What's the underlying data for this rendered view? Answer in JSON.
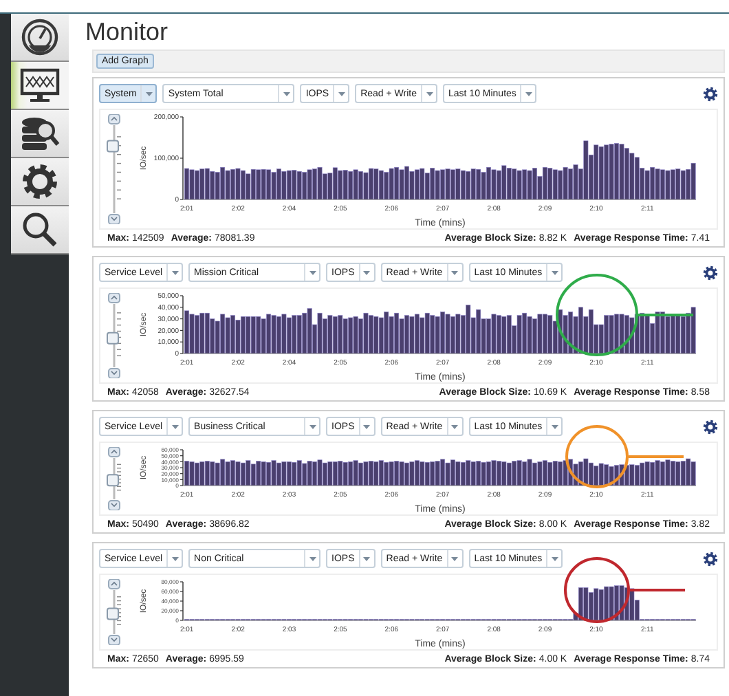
{
  "sidebar": {
    "items": [
      {
        "kind": "dashboard",
        "selected": false
      },
      {
        "kind": "monitor",
        "selected": true
      },
      {
        "kind": "storage",
        "selected": false
      },
      {
        "kind": "settings",
        "selected": false
      },
      {
        "kind": "search",
        "selected": false
      }
    ]
  },
  "page": {
    "title": "Monitor"
  },
  "toolbar": {
    "buttons": [
      "Add Graph"
    ]
  },
  "graphs": [
    {
      "controls": [
        {
          "value": "System",
          "focused": true
        },
        {
          "value": "System Total",
          "focused": false
        },
        {
          "value": "IOPS",
          "focused": false
        },
        {
          "value": "Read + Write",
          "focused": false
        },
        {
          "value": "Last 10 Minutes",
          "focused": false
        }
      ],
      "chart_data": {
        "type": "bar",
        "xlabel": "Time (mins)",
        "ylabel": "IO/sec",
        "ylim": [
          0,
          200000
        ],
        "yticks": [
          {
            "value": 0,
            "label": "0"
          },
          {
            "value": 100000,
            "label": "100,000"
          },
          {
            "value": 200000,
            "label": "200,000"
          }
        ],
        "categories": [
          "2:01",
          null,
          null,
          null,
          null,
          null,
          null,
          null,
          null,
          null,
          "2:02",
          null,
          null,
          null,
          null,
          null,
          null,
          null,
          null,
          null,
          "2:04",
          null,
          null,
          null,
          null,
          null,
          null,
          null,
          null,
          null,
          "2:05",
          null,
          null,
          null,
          null,
          null,
          null,
          null,
          null,
          null,
          "2:06",
          null,
          null,
          null,
          null,
          null,
          null,
          null,
          null,
          null,
          "2:07",
          null,
          null,
          null,
          null,
          null,
          null,
          null,
          null,
          null,
          "2:08",
          null,
          null,
          null,
          null,
          null,
          null,
          null,
          null,
          null,
          "2:09",
          null,
          null,
          null,
          null,
          null,
          null,
          null,
          null,
          null,
          "2:10",
          null,
          null,
          null,
          null,
          null,
          null,
          null,
          null,
          null,
          "2:11",
          null,
          null,
          null,
          null,
          null,
          null,
          null,
          null,
          null
        ],
        "series": [
          {
            "color": "#4a3f6e",
            "values": [
              75000,
              72000,
              70000,
              74000,
              75000,
              68000,
              66000,
              78000,
              70000,
              73000,
              75000,
              70000,
              62000,
              73000,
              72000,
              73000,
              72000,
              66000,
              74000,
              68000,
              70000,
              71000,
              68000,
              66000,
              72000,
              74000,
              78000,
              62000,
              64000,
              77000,
              70000,
              71000,
              68000,
              72000,
              68000,
              65000,
              75000,
              74000,
              70000,
              66000,
              75000,
              78000,
              72000,
              80000,
              68000,
              72000,
              75000,
              64000,
              76000,
              70000,
              72000,
              74000,
              72000,
              74000,
              70000,
              68000,
              74000,
              73000,
              66000,
              78000,
              72000,
              70000,
              82000,
              76000,
              74000,
              70000,
              72000,
              70000,
              76000,
              56000,
              78000,
              76000,
              72000,
              70000,
              78000,
              74000,
              84000,
              74000,
              142000,
              108000,
              132000,
              128000,
              132000,
              134000,
              136000,
              134000,
              124000,
              112000,
              102000,
              76000,
              70000,
              78000,
              74000,
              72000,
              70000,
              72000,
              74000,
              70000,
              73000,
              88000
            ]
          }
        ]
      },
      "stats_left": [
        {
          "label": "Max:",
          "value": "142509"
        },
        {
          "label": "Average:",
          "value": "78081.39"
        }
      ],
      "stats_right": [
        {
          "label": "Average Block Size:",
          "value": "8.82 K"
        },
        {
          "label": "Average Response Time:",
          "value": "7.41"
        }
      ]
    },
    {
      "controls": [
        {
          "value": "Service Level",
          "focused": false
        },
        {
          "value": "Mission Critical",
          "focused": false
        },
        {
          "value": "IOPS",
          "focused": false
        },
        {
          "value": "Read + Write",
          "focused": false
        },
        {
          "value": "Last 10 Minutes",
          "focused": false
        }
      ],
      "highlight": {
        "color": "#2fac4a"
      },
      "chart_data": {
        "type": "bar",
        "xlabel": "Time (mins)",
        "ylabel": "IO/sec",
        "ylim": [
          0,
          50000
        ],
        "yticks": [
          {
            "value": 0,
            "label": "0"
          },
          {
            "value": 10000,
            "label": "10,000"
          },
          {
            "value": 20000,
            "label": "20,000"
          },
          {
            "value": 30000,
            "label": "30,000"
          },
          {
            "value": 40000,
            "label": "40,000"
          },
          {
            "value": 50000,
            "label": "50,000"
          }
        ],
        "categories": [
          "2:01",
          null,
          null,
          null,
          null,
          null,
          null,
          null,
          null,
          null,
          "2:02",
          null,
          null,
          null,
          null,
          null,
          null,
          null,
          null,
          null,
          "2:04",
          null,
          null,
          null,
          null,
          null,
          null,
          null,
          null,
          null,
          "2:05",
          null,
          null,
          null,
          null,
          null,
          null,
          null,
          null,
          null,
          "2:06",
          null,
          null,
          null,
          null,
          null,
          null,
          null,
          null,
          null,
          "2:07",
          null,
          null,
          null,
          null,
          null,
          null,
          null,
          null,
          null,
          "2:08",
          null,
          null,
          null,
          null,
          null,
          null,
          null,
          null,
          null,
          "2:09",
          null,
          null,
          null,
          null,
          null,
          null,
          null,
          null,
          null,
          "2:10",
          null,
          null,
          null,
          null,
          null,
          null,
          null,
          null,
          null,
          "2:11",
          null,
          null,
          null,
          null,
          null,
          null,
          null,
          null,
          null
        ],
        "series": [
          {
            "color": "#4a3f6e",
            "values": [
              37000,
              34000,
              33000,
              35000,
              35000,
              30000,
              28000,
              34000,
              31000,
              33000,
              29000,
              32000,
              32000,
              32000,
              32000,
              30000,
              34000,
              33000,
              32000,
              34000,
              31000,
              33000,
              33000,
              35000,
              39000,
              25000,
              35000,
              30000,
              33000,
              32000,
              33000,
              30000,
              31000,
              32000,
              30000,
              35000,
              33000,
              32000,
              31000,
              36000,
              32000,
              35000,
              30000,
              33000,
              32000,
              34000,
              31000,
              35000,
              33000,
              32000,
              36000,
              34000,
              32000,
              34000,
              33000,
              42000,
              31000,
              38000,
              30000,
              30000,
              34000,
              33000,
              32000,
              33000,
              24000,
              33000,
              35000,
              32000,
              30000,
              34000,
              34000,
              33000,
              28000,
              38000,
              33000,
              36000,
              32000,
              40000,
              32000,
              38000,
              25000,
              25000,
              33000,
              33000,
              34000,
              34000,
              33000,
              31000,
              34000,
              35000,
              34000,
              26000,
              36000,
              36000,
              32000,
              33000,
              34000,
              32000,
              35000,
              40000
            ]
          }
        ]
      },
      "stats_left": [
        {
          "label": "Max:",
          "value": "42058"
        },
        {
          "label": "Average:",
          "value": "32627.54"
        }
      ],
      "stats_right": [
        {
          "label": "Average Block Size:",
          "value": "10.69 K"
        },
        {
          "label": "Average Response Time:",
          "value": "8.58"
        }
      ]
    },
    {
      "controls": [
        {
          "value": "Service Level",
          "focused": false
        },
        {
          "value": "Business Critical",
          "focused": false
        },
        {
          "value": "IOPS",
          "focused": false
        },
        {
          "value": "Read + Write",
          "focused": false
        },
        {
          "value": "Last 10 Minutes",
          "focused": false
        }
      ],
      "highlight": {
        "color": "#f0922a"
      },
      "chart_data": {
        "type": "bar",
        "xlabel": "Time (mins)",
        "ylabel": "IO/sec",
        "ylim": [
          0,
          60000
        ],
        "yticks": [
          {
            "value": 0,
            "label": "0"
          },
          {
            "value": 10000,
            "label": "10,000"
          },
          {
            "value": 20000,
            "label": "20,000"
          },
          {
            "value": 30000,
            "label": "30,000"
          },
          {
            "value": 40000,
            "label": "40,000"
          },
          {
            "value": 50000,
            "label": "50,000"
          },
          {
            "value": 60000,
            "label": "60,000"
          }
        ],
        "categories": [
          "2:01",
          null,
          null,
          null,
          null,
          null,
          null,
          null,
          null,
          null,
          "2:02",
          null,
          null,
          null,
          null,
          null,
          null,
          null,
          null,
          null,
          "2:03",
          null,
          null,
          null,
          null,
          null,
          null,
          null,
          null,
          null,
          "2:05",
          null,
          null,
          null,
          null,
          null,
          null,
          null,
          null,
          null,
          "2:06",
          null,
          null,
          null,
          null,
          null,
          null,
          null,
          null,
          null,
          "2:07",
          null,
          null,
          null,
          null,
          null,
          null,
          null,
          null,
          null,
          "2:08",
          null,
          null,
          null,
          null,
          null,
          null,
          null,
          null,
          null,
          "2:09",
          null,
          null,
          null,
          null,
          null,
          null,
          null,
          null,
          null,
          "2:10",
          null,
          null,
          null,
          null,
          null,
          null,
          null,
          null,
          null,
          "2:11",
          null,
          null,
          null,
          null,
          null,
          null,
          null,
          null,
          null
        ],
        "series": [
          {
            "color": "#4a3f6e",
            "values": [
              41000,
              40000,
              38000,
              40000,
              41000,
              40000,
              38000,
              44000,
              40000,
              42000,
              40000,
              38000,
              42000,
              36000,
              41000,
              40000,
              39000,
              42000,
              38000,
              40000,
              40000,
              39000,
              42000,
              37000,
              41000,
              40000,
              43000,
              38000,
              40000,
              40000,
              41000,
              39000,
              40000,
              42000,
              38000,
              40000,
              41000,
              40000,
              42000,
              39000,
              40000,
              41000,
              40000,
              38000,
              40000,
              42000,
              40000,
              39000,
              40000,
              41000,
              44000,
              38000,
              43000,
              40000,
              39000,
              42000,
              40000,
              41000,
              39000,
              40000,
              42000,
              41000,
              40000,
              38000,
              41000,
              42000,
              40000,
              44000,
              38000,
              40000,
              42000,
              39000,
              41000,
              40000,
              42000,
              44000,
              36000,
              40000,
              45000,
              38000,
              33000,
              37000,
              35000,
              32000,
              34000,
              35000,
              34000,
              35000,
              34000,
              38000,
              40000,
              39000,
              42000,
              40000,
              43000,
              41000,
              40000,
              41000,
              45000,
              40000
            ]
          }
        ]
      },
      "stats_left": [
        {
          "label": "Max:",
          "value": "50490"
        },
        {
          "label": "Average:",
          "value": "38696.82"
        }
      ],
      "stats_right": [
        {
          "label": "Average Block Size:",
          "value": "8.00 K"
        },
        {
          "label": "Average Response Time:",
          "value": "3.82"
        }
      ]
    },
    {
      "controls": [
        {
          "value": "Service Level",
          "focused": false
        },
        {
          "value": "Non Critical",
          "focused": false
        },
        {
          "value": "IOPS",
          "focused": false
        },
        {
          "value": "Read + Write",
          "focused": false
        },
        {
          "value": "Last 10 Minutes",
          "focused": false
        }
      ],
      "highlight": {
        "color": "#c0282e"
      },
      "chart_data": {
        "type": "bar",
        "xlabel": "Time (mins)",
        "ylabel": "IO/sec",
        "ylim": [
          0,
          80000
        ],
        "yticks": [
          {
            "value": 0,
            "label": "0"
          },
          {
            "value": 20000,
            "label": "20,000"
          },
          {
            "value": 40000,
            "label": "40,000"
          },
          {
            "value": 60000,
            "label": "60,000"
          },
          {
            "value": 80000,
            "label": "80,000"
          }
        ],
        "categories": [
          "2:01",
          null,
          null,
          null,
          null,
          null,
          null,
          null,
          null,
          null,
          "2:02",
          null,
          null,
          null,
          null,
          null,
          null,
          null,
          null,
          null,
          "2:03",
          null,
          null,
          null,
          null,
          null,
          null,
          null,
          null,
          null,
          "2:05",
          null,
          null,
          null,
          null,
          null,
          null,
          null,
          null,
          null,
          "2:06",
          null,
          null,
          null,
          null,
          null,
          null,
          null,
          null,
          null,
          "2:07",
          null,
          null,
          null,
          null,
          null,
          null,
          null,
          null,
          null,
          "2:08",
          null,
          null,
          null,
          null,
          null,
          null,
          null,
          null,
          null,
          "2:09",
          null,
          null,
          null,
          null,
          null,
          null,
          null,
          null,
          null,
          "2:10",
          null,
          null,
          null,
          null,
          null,
          null,
          null,
          null,
          null,
          "2:11",
          null,
          null,
          null,
          null,
          null,
          null,
          null,
          null,
          null
        ],
        "series": [
          {
            "color": "#4a3f6e",
            "values": [
              0,
              0,
              0,
              0,
              0,
              0,
              0,
              0,
              0,
              0,
              0,
              0,
              0,
              0,
              0,
              0,
              0,
              0,
              0,
              0,
              0,
              0,
              0,
              0,
              0,
              0,
              0,
              0,
              0,
              0,
              0,
              0,
              0,
              0,
              0,
              0,
              0,
              0,
              0,
              0,
              0,
              0,
              0,
              0,
              0,
              0,
              0,
              0,
              0,
              0,
              0,
              0,
              0,
              0,
              0,
              0,
              0,
              0,
              0,
              0,
              0,
              0,
              0,
              0,
              0,
              0,
              0,
              0,
              0,
              0,
              0,
              0,
              0,
              0,
              0,
              0,
              15000,
              68000,
              68000,
              58000,
              66000,
              64000,
              70000,
              70000,
              72000,
              72000,
              68000,
              66000,
              42000,
              0,
              0,
              0,
              0,
              0,
              0,
              0,
              0,
              0,
              0,
              0
            ]
          }
        ]
      },
      "stats_left": [
        {
          "label": "Max:",
          "value": "72650"
        },
        {
          "label": "Average:",
          "value": "6995.59"
        }
      ],
      "stats_right": [
        {
          "label": "Average Block Size:",
          "value": "4.00 K"
        },
        {
          "label": "Average Response Time:",
          "value": "8.74"
        }
      ]
    }
  ]
}
